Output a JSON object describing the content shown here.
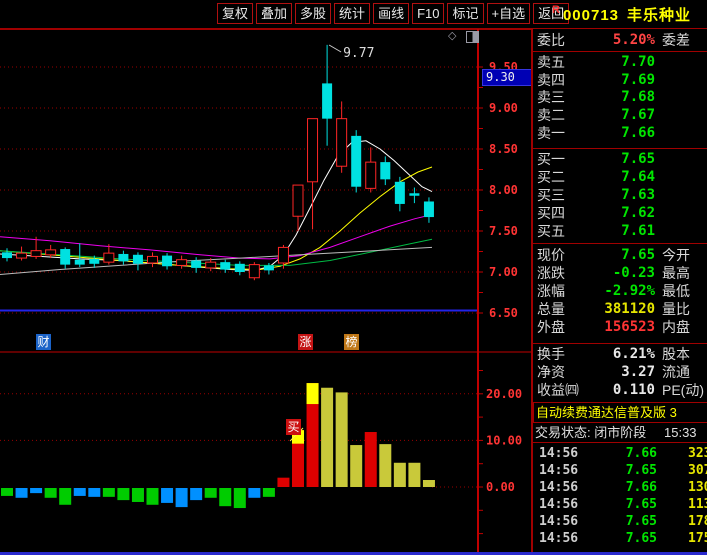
{
  "colors": {
    "up_candle": "#ff2626",
    "down_candle": "#00e1e1",
    "grid": "#990000",
    "axis": "#c00000",
    "axis_label": "#ff3434",
    "ma5": "#ffffff",
    "ma10": "#ffff00",
    "ma20": "#ee00ee",
    "ma60": "#00bb44",
    "ma250": "#bbbbbb",
    "support_line": "#2323e6",
    "bar_green": "#00cc00",
    "bar_blue": "#0090ff",
    "bar_red": "#dd0000",
    "bar_khaki": "#c9c93a",
    "bar_cap_yellow": "#ffff00"
  },
  "toolbar": {
    "buttons": [
      "复权",
      "叠加",
      "多股",
      "统计",
      "画线",
      "F10",
      "标记",
      "+自选",
      "返回"
    ],
    "r_badge": "R",
    "stock_code": "000713",
    "stock_name": "丰乐种业"
  },
  "icons": {
    "diamond": "◇"
  },
  "price_tag": "9.30",
  "buy_marker": "买",
  "tabs": [
    {
      "label": "财"
    },
    {
      "label": "涨"
    },
    {
      "label": "榜"
    }
  ],
  "chart_data": {
    "type": "candlestick+bar",
    "price_axis": [
      "9.50",
      "9.00",
      "8.50",
      "8.00",
      "7.50",
      "7.00",
      "6.50"
    ],
    "indicator_axis": [
      "20.00",
      "10.00",
      "0.00"
    ],
    "high_annotation": "9.77",
    "support_line_price": 6.53,
    "candles": [
      {
        "t": "d",
        "o": 7.24,
        "c": 7.17,
        "h": 7.29,
        "l": 7.13
      },
      {
        "t": "u",
        "o": 7.17,
        "c": 7.23,
        "h": 7.31,
        "l": 7.14
      },
      {
        "t": "u",
        "o": 7.19,
        "c": 7.26,
        "h": 7.43,
        "l": 7.16
      },
      {
        "t": "u",
        "o": 7.21,
        "c": 7.27,
        "h": 7.33,
        "l": 7.17
      },
      {
        "t": "d",
        "o": 7.28,
        "c": 7.09,
        "h": 7.3,
        "l": 7.04
      },
      {
        "t": "d",
        "o": 7.15,
        "c": 7.09,
        "h": 7.35,
        "l": 7.06
      },
      {
        "t": "d",
        "o": 7.16,
        "c": 7.1,
        "h": 7.2,
        "l": 7.05
      },
      {
        "t": "u",
        "o": 7.12,
        "c": 7.23,
        "h": 7.34,
        "l": 7.09
      },
      {
        "t": "d",
        "o": 7.22,
        "c": 7.13,
        "h": 7.26,
        "l": 7.09
      },
      {
        "t": "d",
        "o": 7.21,
        "c": 7.1,
        "h": 7.24,
        "l": 7.02
      },
      {
        "t": "u",
        "o": 7.11,
        "c": 7.19,
        "h": 7.24,
        "l": 7.06
      },
      {
        "t": "d",
        "o": 7.2,
        "c": 7.07,
        "h": 7.23,
        "l": 7.03
      },
      {
        "t": "u",
        "o": 7.08,
        "c": 7.15,
        "h": 7.2,
        "l": 7.04
      },
      {
        "t": "d",
        "o": 7.14,
        "c": 7.05,
        "h": 7.18,
        "l": 6.99
      },
      {
        "t": "u",
        "o": 7.05,
        "c": 7.12,
        "h": 7.17,
        "l": 7.01
      },
      {
        "t": "d",
        "o": 7.12,
        "c": 7.03,
        "h": 7.15,
        "l": 6.99
      },
      {
        "t": "d",
        "o": 7.1,
        "c": 7.0,
        "h": 7.13,
        "l": 6.96
      },
      {
        "t": "u",
        "o": 6.93,
        "c": 7.09,
        "h": 7.12,
        "l": 6.9
      },
      {
        "t": "d",
        "o": 7.08,
        "c": 7.02,
        "h": 7.11,
        "l": 6.97
      },
      {
        "t": "u",
        "o": 7.11,
        "c": 7.3,
        "h": 7.33,
        "l": 7.04
      },
      {
        "t": "u",
        "o": 7.68,
        "c": 8.06,
        "h": 8.06,
        "l": 7.5
      },
      {
        "t": "u",
        "o": 8.1,
        "c": 8.87,
        "h": 8.87,
        "l": 7.52
      },
      {
        "t": "d",
        "o": 9.3,
        "c": 8.87,
        "h": 9.77,
        "l": 8.54
      },
      {
        "t": "u",
        "o": 8.29,
        "c": 8.87,
        "h": 9.08,
        "l": 8.21
      },
      {
        "t": "d",
        "o": 8.66,
        "c": 8.04,
        "h": 8.73,
        "l": 7.97
      },
      {
        "t": "u",
        "o": 8.02,
        "c": 8.34,
        "h": 8.52,
        "l": 7.97
      },
      {
        "t": "d",
        "o": 8.34,
        "c": 8.13,
        "h": 8.41,
        "l": 8.06
      },
      {
        "t": "d",
        "o": 8.1,
        "c": 7.83,
        "h": 8.16,
        "l": 7.74
      },
      {
        "t": "d",
        "o": 7.96,
        "c": 7.93,
        "h": 8.03,
        "l": 7.84
      },
      {
        "t": "d",
        "o": 7.86,
        "c": 7.67,
        "h": 7.91,
        "l": 7.6
      }
    ],
    "ma_lines": [
      {
        "name": "MA5",
        "color": "#ffffff",
        "points": [
          [
            0,
            7.22
          ],
          [
            40,
            7.19
          ],
          [
            80,
            7.16
          ],
          [
            120,
            7.14
          ],
          [
            160,
            7.1
          ],
          [
            200,
            7.06
          ],
          [
            230,
            7.03
          ],
          [
            255,
            7.02
          ],
          [
            270,
            7.07
          ],
          [
            283,
            7.2
          ],
          [
            296,
            7.45
          ],
          [
            310,
            7.78
          ],
          [
            324,
            8.12
          ],
          [
            338,
            8.42
          ],
          [
            352,
            8.58
          ],
          [
            366,
            8.6
          ],
          [
            380,
            8.5
          ],
          [
            394,
            8.36
          ],
          [
            408,
            8.2
          ],
          [
            422,
            8.04
          ],
          [
            432,
            7.98
          ]
        ]
      },
      {
        "name": "MA10",
        "color": "#ffff00",
        "points": [
          [
            0,
            7.26
          ],
          [
            60,
            7.2
          ],
          [
            120,
            7.14
          ],
          [
            180,
            7.08
          ],
          [
            230,
            7.04
          ],
          [
            260,
            7.03
          ],
          [
            280,
            7.07
          ],
          [
            300,
            7.16
          ],
          [
            320,
            7.3
          ],
          [
            340,
            7.5
          ],
          [
            360,
            7.72
          ],
          [
            380,
            7.92
          ],
          [
            400,
            8.1
          ],
          [
            418,
            8.22
          ],
          [
            432,
            8.28
          ]
        ]
      },
      {
        "name": "MA20",
        "color": "#ee00ee",
        "points": [
          [
            0,
            7.43
          ],
          [
            50,
            7.38
          ],
          [
            100,
            7.32
          ],
          [
            150,
            7.27
          ],
          [
            200,
            7.21
          ],
          [
            240,
            7.17
          ],
          [
            270,
            7.16
          ],
          [
            300,
            7.2
          ],
          [
            330,
            7.3
          ],
          [
            360,
            7.43
          ],
          [
            390,
            7.56
          ],
          [
            415,
            7.65
          ],
          [
            432,
            7.7
          ]
        ]
      },
      {
        "name": "MA60",
        "color": "#00bb44",
        "points": [
          [
            0,
            7.26
          ],
          [
            60,
            7.21
          ],
          [
            120,
            7.16
          ],
          [
            180,
            7.12
          ],
          [
            240,
            7.08
          ],
          [
            290,
            7.08
          ],
          [
            330,
            7.14
          ],
          [
            370,
            7.24
          ],
          [
            405,
            7.33
          ],
          [
            432,
            7.4
          ]
        ]
      },
      {
        "name": "MA250",
        "color": "#bbbbbb",
        "points": [
          [
            0,
            6.97
          ],
          [
            60,
            7.03
          ],
          [
            120,
            7.08
          ],
          [
            180,
            7.13
          ],
          [
            240,
            7.17
          ],
          [
            300,
            7.21
          ],
          [
            360,
            7.25
          ],
          [
            432,
            7.3
          ]
        ]
      }
    ],
    "indicator_bars": [
      {
        "c": "g",
        "v": -1.7
      },
      {
        "c": "b",
        "v": -2.1
      },
      {
        "c": "b",
        "v": -1.1
      },
      {
        "c": "g",
        "v": -2.1
      },
      {
        "c": "g",
        "v": -3.6
      },
      {
        "c": "b",
        "v": -1.7
      },
      {
        "c": "b",
        "v": -1.9
      },
      {
        "c": "g",
        "v": -1.9
      },
      {
        "c": "g",
        "v": -2.6
      },
      {
        "c": "g",
        "v": -3.0
      },
      {
        "c": "g",
        "v": -3.6
      },
      {
        "c": "b",
        "v": -3.2
      },
      {
        "c": "b",
        "v": -4.1
      },
      {
        "c": "b",
        "v": -2.6
      },
      {
        "c": "g",
        "v": -2.1
      },
      {
        "c": "g",
        "v": -3.9
      },
      {
        "c": "g",
        "v": -4.3
      },
      {
        "c": "b",
        "v": -2.1
      },
      {
        "c": "g",
        "v": -1.9
      },
      {
        "c": "r",
        "v": 2.0
      },
      {
        "c": "r",
        "v": 12.2,
        "cap": 9.3
      },
      {
        "c": "r",
        "v": 22.3,
        "cap": 17.8
      },
      {
        "c": "k",
        "v": 21.3
      },
      {
        "c": "k",
        "v": 20.3
      },
      {
        "c": "k",
        "v": 9.0
      },
      {
        "c": "r",
        "v": 11.8
      },
      {
        "c": "k",
        "v": 9.2
      },
      {
        "c": "k",
        "v": 5.2
      },
      {
        "c": "k",
        "v": 5.2
      },
      {
        "c": "k",
        "v": 1.5
      }
    ]
  },
  "panel": {
    "header": {
      "weibi_label": "委比",
      "weibi_value": "5.20%",
      "weicha_label": "委差"
    },
    "asks": [
      {
        "label": "卖五",
        "price": "7.70"
      },
      {
        "label": "卖四",
        "price": "7.69"
      },
      {
        "label": "卖三",
        "price": "7.68"
      },
      {
        "label": "卖二",
        "price": "7.67"
      },
      {
        "label": "卖一",
        "price": "7.66"
      }
    ],
    "bids": [
      {
        "label": "买一",
        "price": "7.65"
      },
      {
        "label": "买二",
        "price": "7.64"
      },
      {
        "label": "买三",
        "price": "7.63"
      },
      {
        "label": "买四",
        "price": "7.62"
      },
      {
        "label": "买五",
        "price": "7.61"
      }
    ],
    "stats": [
      {
        "label": "现价",
        "value": "7.65",
        "label2": "今开"
      },
      {
        "label": "涨跌",
        "value": "-0.23",
        "label2": "最高"
      },
      {
        "label": "涨幅",
        "value": "-2.92%",
        "label2": "最低"
      },
      {
        "label": "总量",
        "value": "381120",
        "label2": "量比"
      },
      {
        "label": "外盘",
        "value": "156523",
        "label2": "内盘"
      }
    ],
    "fin": [
      {
        "label": "换手",
        "value": "6.21%",
        "label2": "股本"
      },
      {
        "label": "净资",
        "value": "3.27",
        "label2": "流通"
      },
      {
        "label": "收益㈣",
        "value": "0.110",
        "label2": "PE(动)"
      }
    ],
    "notice": "自动续费通达信普及版 3",
    "status_label": "交易状态: 闭市阶段",
    "status_time": "15:33",
    "ticks": [
      {
        "time": "14:56",
        "price": "7.66",
        "vol": "323"
      },
      {
        "time": "14:56",
        "price": "7.65",
        "vol": "307"
      },
      {
        "time": "14:56",
        "price": "7.66",
        "vol": "130"
      },
      {
        "time": "14:56",
        "price": "7.65",
        "vol": "113"
      },
      {
        "time": "14:56",
        "price": "7.65",
        "vol": "178"
      },
      {
        "time": "14:56",
        "price": "7.65",
        "vol": "175"
      }
    ]
  }
}
